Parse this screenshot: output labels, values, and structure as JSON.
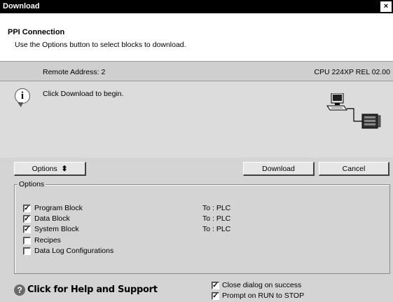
{
  "window": {
    "title": "Download",
    "close_label": "×"
  },
  "header": {
    "title": "PPI Connection",
    "subtitle": "Use the Options button to select blocks to download."
  },
  "connection": {
    "remote_address": "Remote Address: 2",
    "cpu": "CPU 224XP REL 02.00"
  },
  "info": {
    "icon": "info-icon",
    "message": "Click Download to begin."
  },
  "buttons": {
    "options": "Options",
    "options_arrow": "≙",
    "download": "Download",
    "cancel": "Cancel"
  },
  "options": {
    "legend": "Options",
    "items": [
      {
        "label": "Program Block",
        "checked": true,
        "dest": "To : PLC"
      },
      {
        "label": "Data Block",
        "checked": true,
        "dest": "To : PLC"
      },
      {
        "label": "System Block",
        "checked": true,
        "dest": "To : PLC"
      },
      {
        "label": "Recipes",
        "checked": false,
        "dest": ""
      },
      {
        "label": "Data Log Configurations",
        "checked": false,
        "dest": ""
      }
    ]
  },
  "footer": {
    "help_label": "Click for Help and Support",
    "close_on_success": {
      "label": "Close dialog on success",
      "checked": true
    },
    "prompt_run_stop": {
      "label": "Prompt on RUN to STOP",
      "checked": true
    }
  }
}
